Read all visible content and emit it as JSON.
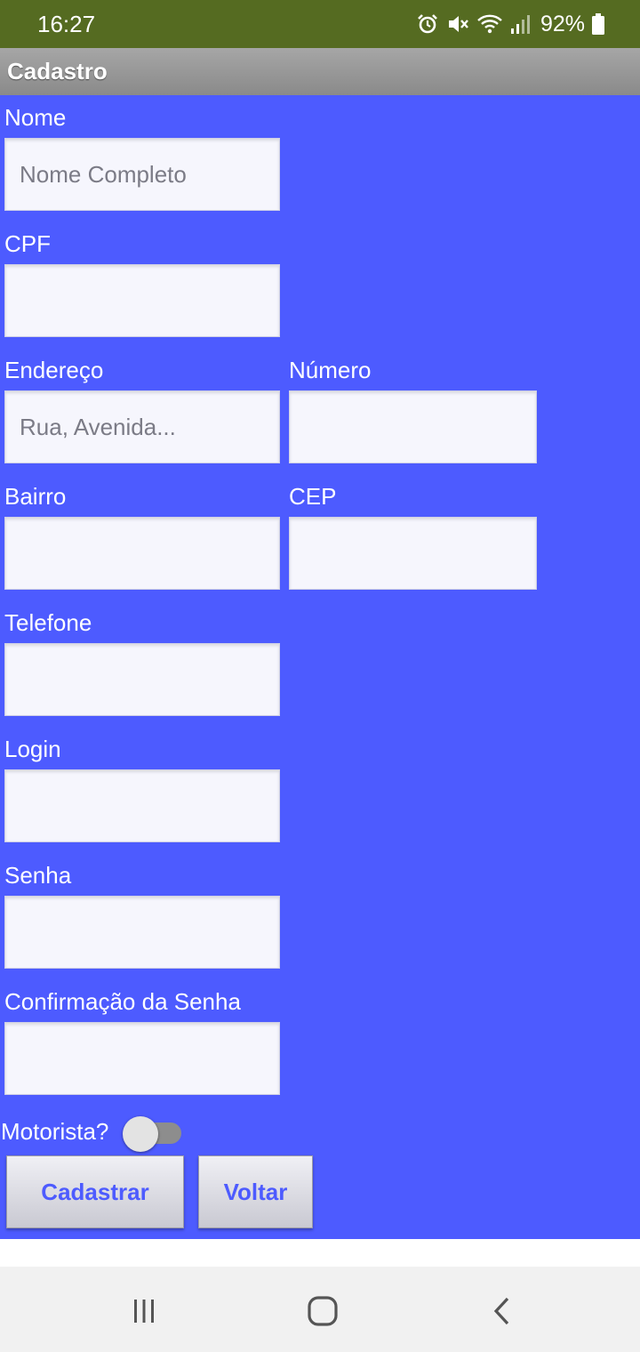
{
  "status_bar": {
    "time": "16:27",
    "battery_percent": "92%",
    "icons": [
      "alarm-icon",
      "mute-icon",
      "wifi-icon",
      "signal-icon",
      "battery-icon"
    ]
  },
  "app": {
    "title": "Cadastro"
  },
  "form": {
    "nome": {
      "label": "Nome",
      "placeholder": "Nome Completo",
      "value": ""
    },
    "cpf": {
      "label": "CPF",
      "placeholder": "",
      "value": ""
    },
    "endereco": {
      "label": "Endereço",
      "placeholder": "Rua, Avenida...",
      "value": ""
    },
    "numero": {
      "label": "Número",
      "placeholder": "",
      "value": ""
    },
    "bairro": {
      "label": "Bairro",
      "placeholder": "",
      "value": ""
    },
    "cep": {
      "label": "CEP",
      "placeholder": "",
      "value": ""
    },
    "telefone": {
      "label": "Telefone",
      "placeholder": "",
      "value": ""
    },
    "login": {
      "label": "Login",
      "placeholder": "",
      "value": ""
    },
    "senha": {
      "label": "Senha",
      "placeholder": "",
      "value": ""
    },
    "confirmacao": {
      "label": "Confirmação da Senha",
      "placeholder": "",
      "value": ""
    },
    "motorista": {
      "label": "Motorista?",
      "checked": false
    }
  },
  "buttons": {
    "cadastrar": "Cadastrar",
    "voltar": "Voltar"
  },
  "colors": {
    "form_background": "#4d5bff",
    "status_bar": "#556b21",
    "title_bar": "#999999",
    "button_text": "#4d5bff"
  },
  "nav_bar": {
    "icons": [
      "recent-apps-icon",
      "home-icon",
      "back-icon"
    ]
  }
}
